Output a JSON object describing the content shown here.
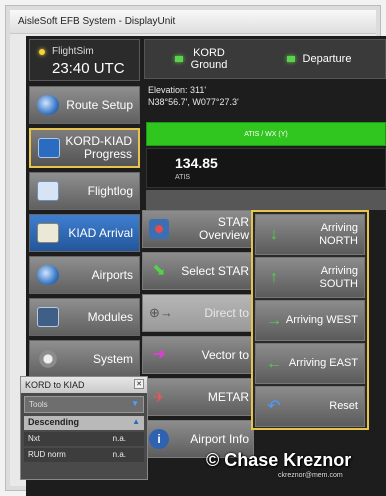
{
  "window": {
    "title": "AisleSoft EFB System - DisplayUnit"
  },
  "clock": {
    "label": "FlightSim",
    "time": "23:40 UTC"
  },
  "nav": [
    {
      "label": "Route Setup",
      "icon": "globe-icon"
    },
    {
      "label": "KORD-KIAD Progress",
      "icon": "airplane-icon"
    },
    {
      "label": "Flightlog",
      "icon": "logbook-icon"
    },
    {
      "label": "KIAD Arrival",
      "icon": "clipboard-icon"
    },
    {
      "label": "Airports",
      "icon": "globe-icon"
    },
    {
      "label": "Modules",
      "icon": "module-icon"
    },
    {
      "label": "System",
      "icon": "gear-icon"
    }
  ],
  "airport": {
    "code": "KORD",
    "sub": "Ground",
    "phase": "Departure",
    "elevation": "Elevation: 311'",
    "coords": "N38°56.7', W077°27.3'"
  },
  "atis": {
    "label": "ATIS / WX (Y)",
    "freq": "134.85",
    "unit": "ATIS"
  },
  "popup": [
    {
      "label": "STAR Overview",
      "icon": "map-icon",
      "disabled": false
    },
    {
      "label": "Select STAR",
      "icon": "select-arrow-icon",
      "disabled": false
    },
    {
      "label": "Direct to",
      "icon": "direct-to-icon",
      "disabled": true
    },
    {
      "label": "Vector to",
      "icon": "vector-arrow-icon",
      "disabled": false
    },
    {
      "label": "METAR",
      "icon": "metar-icon",
      "disabled": false
    },
    {
      "label": "Airport Info",
      "icon": "info-icon",
      "disabled": false
    }
  ],
  "star": [
    {
      "label": "Arriving NORTH",
      "glyph": "↓"
    },
    {
      "label": "Arriving SOUTH",
      "glyph": "↑"
    },
    {
      "label": "Arriving WEST",
      "glyph": "→"
    },
    {
      "label": "Arriving EAST",
      "glyph": "←"
    },
    {
      "label": "Reset",
      "glyph": "↶"
    }
  ],
  "miniwindow": {
    "title": "KORD to KIAD",
    "dropdown": "Tools",
    "section": "Descending",
    "rows": [
      {
        "label": "Nxt",
        "value": "n.a."
      },
      {
        "label": "RUD norm",
        "value": "n.a."
      }
    ]
  },
  "watermark": {
    "name": "© Chase Kreznor",
    "email": "ckreznor@mem.com"
  }
}
